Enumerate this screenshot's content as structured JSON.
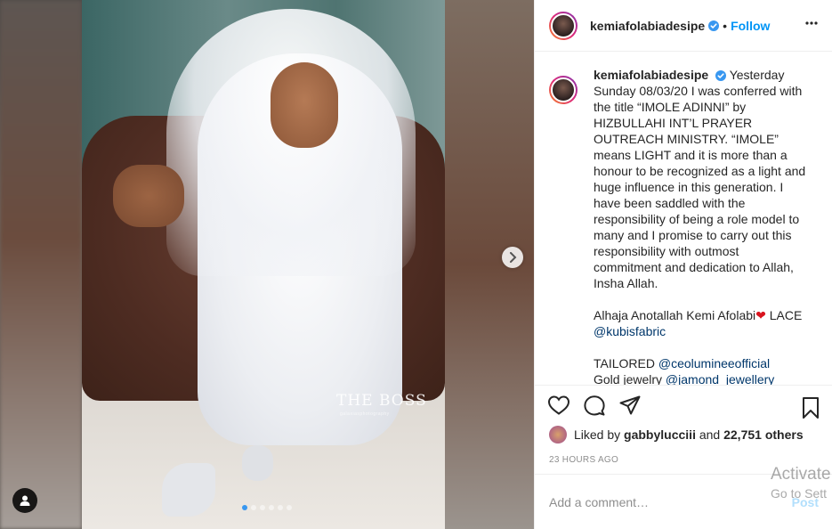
{
  "post": {
    "username": "kemiafolabiadesipe",
    "follow_label": "Follow",
    "separator": "•",
    "caption": {
      "username": "kemiafolabiadesipe",
      "time": "Yesterday",
      "body": "Sunday 08/03/20 I was conferred with the title “IMOLE ADINNI” by HIZBULLAHI INT’L PRAYER OUTREACH MINISTRY. “IMOLE” means LIGHT and it is more than a honour to be recognized as a light and huge influence in this generation. I have been saddled with the responsibility of being a role model to many and I promise to carry out this responsibility with outmost commitment and dedication to Allah, Insha Allah.",
      "credit_line1_prefix": "Alhaja Anotallah Kemi Afolabi",
      "credit_heart": "❤",
      "credit_line1_suffix": " LACE",
      "credit_line1_mention": "@kubisfabric",
      "credit_line2_prefix": "TAILORED ",
      "credit_line2_mention": "@ceolumineeofficial",
      "credit_line3_prefix": "Gold jewelry ",
      "credit_line3_mention": "@jamond_jewellery"
    },
    "likes": {
      "prefix": "Liked by ",
      "user": "gabbylucciii",
      "middle": " and ",
      "count": "22,751 others"
    },
    "timestamp": "23 hours ago",
    "comment_placeholder": "Add a comment…",
    "post_label": "Post",
    "watermark": "THE BOSS",
    "watermark_sub": "galaxiasphotography",
    "carousel": {
      "total": 6,
      "active": 0
    }
  },
  "icons": {
    "more": "more-options-icon",
    "verified": "verified-badge-icon",
    "like": "heart-icon",
    "comment": "comment-bubble-icon",
    "share": "paper-plane-icon",
    "save": "bookmark-icon",
    "next": "chevron-right-icon",
    "tag": "user-tag-icon"
  },
  "colors": {
    "accent": "#0095f6",
    "verified": "#3897f0",
    "heart": "#d9141e",
    "mention": "#00376b",
    "muted": "#8e8e8e",
    "post_disabled": "#b2dffc"
  },
  "os_overlay": {
    "line1": "Activate",
    "line2": "Go to Sett"
  }
}
